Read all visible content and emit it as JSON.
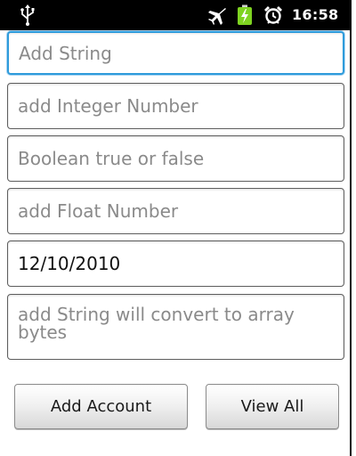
{
  "status_bar": {
    "time": "16:58",
    "icons": [
      "usb-icon",
      "airplane-mode-icon",
      "battery-charging-icon",
      "alarm-icon"
    ],
    "battery_color": "#7ed321"
  },
  "form": {
    "string_field": {
      "placeholder": "Add String",
      "value": ""
    },
    "integer_field": {
      "placeholder": "add Integer Number",
      "value": ""
    },
    "boolean_field": {
      "placeholder": "Boolean true or false",
      "value": ""
    },
    "float_field": {
      "placeholder": "add Float Number",
      "value": ""
    },
    "date_field": {
      "placeholder": "",
      "value": "12/10/2010"
    },
    "bytes_field": {
      "placeholder": "add String will convert to array bytes",
      "value": ""
    }
  },
  "buttons": {
    "add_account": "Add Account",
    "view_all": "View All"
  },
  "colors": {
    "focus_border": "#2e9bdb",
    "status_bar_bg": "#000000"
  }
}
